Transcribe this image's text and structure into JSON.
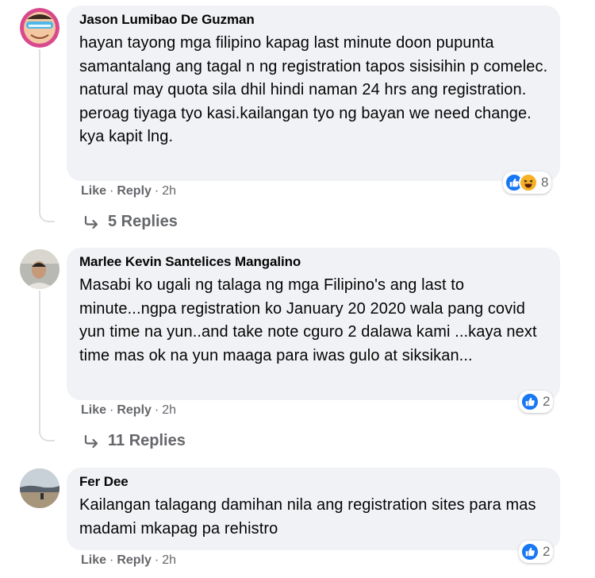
{
  "comments": [
    {
      "author": "Jason Lumibao De Guzman",
      "text": "hayan tayong mga filipino kapag last minute doon pupunta samantalang ang tagal n ng registration tapos sisisihin p comelec. natural may quota sila dhil hindi naman 24 hrs ang registration. peroag tiyaga tyo kasi.kailangan tyo ng bayan we need change. kya kapit lng.",
      "like_label": "Like",
      "reply_label": "Reply",
      "time": "2h",
      "reaction_count": "8",
      "reactions": [
        "like-icon",
        "haha-icon"
      ],
      "replies_label": "5 Replies"
    },
    {
      "author": "Marlee Kevin Santelices Mangalino",
      "text": "Masabi ko ugali ng talaga ng mga Filipino's ang last to minute...ngpa registration ko January 20 2020 wala pang covid yun time na yun..and take note cguro 2 dalawa kami ...kaya next time mas ok na yun maaga para iwas gulo at siksikan...",
      "like_label": "Like",
      "reply_label": "Reply",
      "time": "2h",
      "reaction_count": "2",
      "reactions": [
        "like-icon"
      ],
      "replies_label": "11 Replies"
    },
    {
      "author": "Fer Dee",
      "text": "Kailangan talagang damihan nila ang registration sites para mas madami mkapag pa rehistro",
      "like_label": "Like",
      "reply_label": "Reply",
      "time": "2h",
      "reaction_count": "2",
      "reactions": [
        "like-icon"
      ]
    }
  ],
  "colors": {
    "bubble": "#f0f2f5",
    "secondary_text": "#65676b",
    "like_blue": "#1877f2",
    "haha_yellow": "#f7b125",
    "thread_line": "#dcdfe3"
  }
}
